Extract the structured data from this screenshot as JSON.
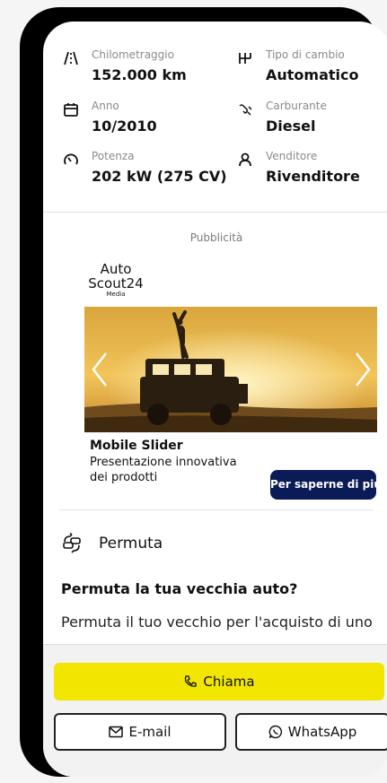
{
  "specs": [
    {
      "icon": "mileage-icon",
      "label": "Chilometraggio",
      "value": "152.000 km"
    },
    {
      "icon": "gearbox-icon",
      "label": "Tipo di cambio",
      "value": "Automatico"
    },
    {
      "icon": "calendar-icon",
      "label": "Anno",
      "value": "10/2010"
    },
    {
      "icon": "fuel-pump-icon",
      "label": "Carburante",
      "value": "Diesel"
    },
    {
      "icon": "speedometer-icon",
      "label": "Potenza",
      "value": "202 kW (275 CV)"
    },
    {
      "icon": "person-icon",
      "label": "Venditore",
      "value": "Rivenditore"
    }
  ],
  "ad": {
    "label": "Pubblicità",
    "brand_line1": "Auto",
    "brand_line2": "Scout24",
    "brand_line3": "Media",
    "title": "Mobile Slider",
    "description": "Presentazione innovativa dei prodotti",
    "cta": "Per saperne di più"
  },
  "trade_in": {
    "icon": "car-swap-icon",
    "heading": "Permuta",
    "question": "Permuta la tua vecchia auto?",
    "text": "Permuta il tuo vecchio per l'acquisto di uno nuovo"
  },
  "actions": {
    "call": "Chiama",
    "email": "E-mail",
    "whatsapp": "WhatsApp"
  },
  "colors": {
    "accent_yellow": "#f2e600",
    "cta_navy": "#0b1b57"
  }
}
